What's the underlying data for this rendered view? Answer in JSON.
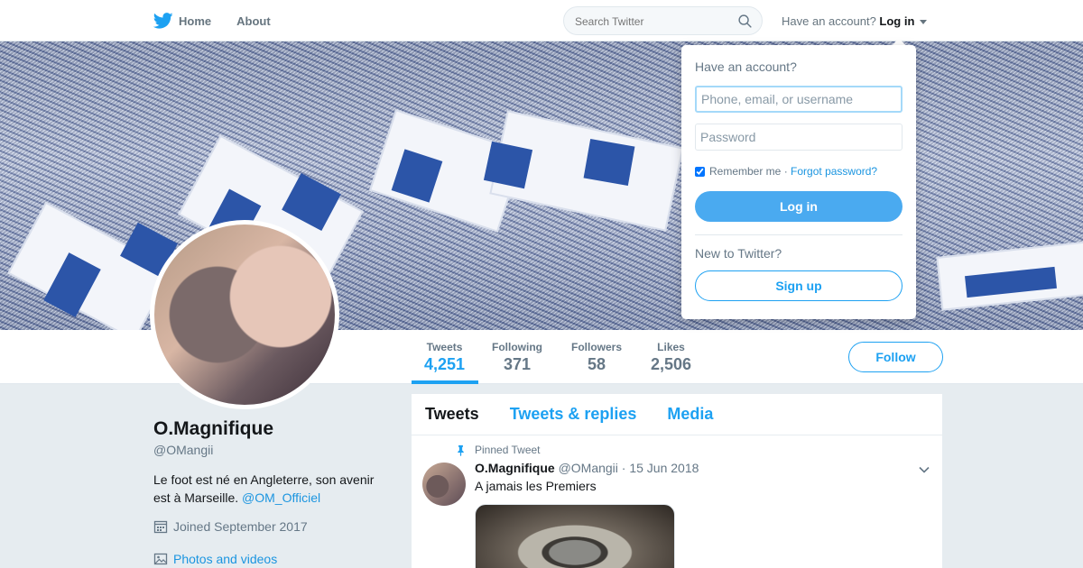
{
  "nav": {
    "home_label": "Home",
    "about_label": "About",
    "search_placeholder": "Search Twitter",
    "account_prompt": "Have an account?",
    "login_label": "Log in"
  },
  "profile": {
    "name": "O.Magnifique",
    "handle": "@OMangii",
    "bio_text": "Le foot est né en Angleterre, son avenir est à Marseille.",
    "bio_mention": "@OM_Officiel",
    "joined": "Joined September 2017",
    "photos_link": "Photos and videos",
    "follow_label": "Follow"
  },
  "stats": [
    {
      "label": "Tweets",
      "value": "4,251",
      "active": true
    },
    {
      "label": "Following",
      "value": "371"
    },
    {
      "label": "Followers",
      "value": "58"
    },
    {
      "label": "Likes",
      "value": "2,506"
    }
  ],
  "timeline": {
    "tabs": [
      "Tweets",
      "Tweets & replies",
      "Media"
    ],
    "pinned_label": "Pinned Tweet",
    "tweet": {
      "name": "O.Magnifique",
      "handle": "@OMangii",
      "date": "· 15 Jun 2018",
      "text": "A jamais les Premiers"
    }
  },
  "login_dropdown": {
    "title": "Have an account?",
    "username_placeholder": "Phone, email, or username",
    "password_placeholder": "Password",
    "remember_label": "Remember me",
    "separator": "·",
    "forgot_label": "Forgot password?",
    "login_button": "Log in",
    "new_prompt": "New to Twitter?",
    "signup_button": "Sign up"
  },
  "colors": {
    "accent": "#1da1f2",
    "login_button_bg": "#4aaaf0",
    "page_bg": "#e6ecf0"
  },
  "icons": [
    "twitter-bird-icon",
    "search-icon",
    "caret-down-icon",
    "calendar-icon",
    "photo-icon",
    "pin-icon",
    "chevron-down-icon"
  ]
}
